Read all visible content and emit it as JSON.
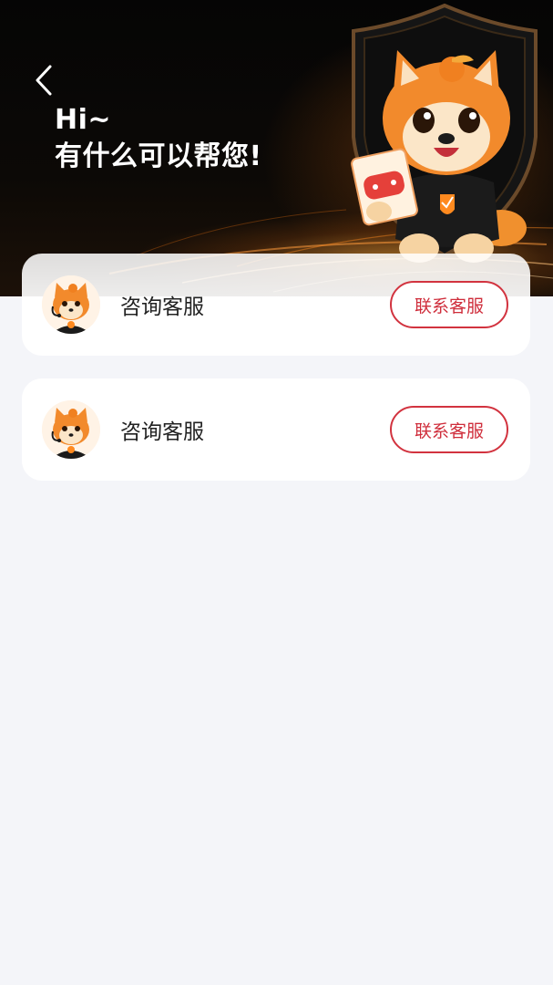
{
  "header": {
    "back_icon": "chevron-left-icon",
    "greeting_line1": "Hi~",
    "greeting_line2": "有什么可以帮您!",
    "mascot_icon": "shiba-mascot-with-shield-icon"
  },
  "services": [
    {
      "title": "咨询客服",
      "button_label": "联系客服",
      "avatar_icon": "shiba-agent-avatar-icon"
    },
    {
      "title": "咨询客服",
      "button_label": "联系客服",
      "avatar_icon": "shiba-agent-avatar-icon"
    }
  ],
  "colors": {
    "accent": "#d2333f",
    "page_bg": "#f4f5f9",
    "hero_bg": "#050505",
    "glow": "#ff9a2e"
  }
}
